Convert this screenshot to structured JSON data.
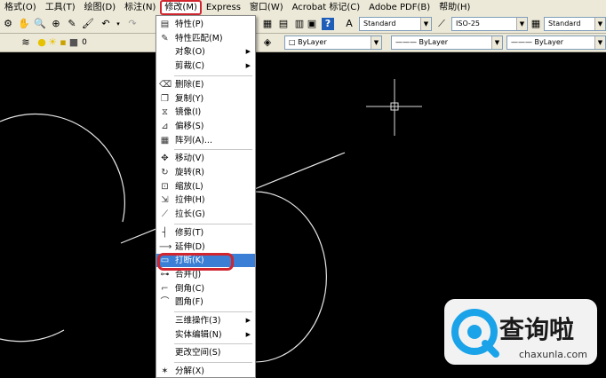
{
  "menubar": {
    "items": [
      "格式(O)",
      "工具(T)",
      "绘图(D)",
      "标注(N)",
      "修改(M)",
      "Express",
      "窗口(W)",
      "Acrobat 标记(C)",
      "Adobe PDF(B)",
      "帮助(H)"
    ],
    "active_index": 4
  },
  "toolbar": {
    "text_style": "Standard",
    "dim_style": "ISO-25",
    "table_style": "Standard",
    "layer_value": "0",
    "color": "ByLayer",
    "linetype": "ByLayer",
    "lineweight": "ByLayer"
  },
  "menu": {
    "items": [
      {
        "label": "特性(P)",
        "icon": "properties-icon"
      },
      {
        "label": "特性匹配(M)",
        "icon": "match-properties-icon"
      },
      {
        "label": "对象(O)",
        "icon": "",
        "sub": true
      },
      {
        "label": "剪裁(C)",
        "icon": "",
        "sub": true
      },
      {
        "label": "删除(E)",
        "icon": "erase-icon"
      },
      {
        "label": "复制(Y)",
        "icon": "copy-icon"
      },
      {
        "label": "镜像(I)",
        "icon": "mirror-icon"
      },
      {
        "label": "偏移(S)",
        "icon": "offset-icon"
      },
      {
        "label": "阵列(A)...",
        "icon": "array-icon"
      },
      {
        "label": "移动(V)",
        "icon": "move-icon"
      },
      {
        "label": "旋转(R)",
        "icon": "rotate-icon"
      },
      {
        "label": "缩放(L)",
        "icon": "scale-icon"
      },
      {
        "label": "拉伸(H)",
        "icon": "stretch-icon"
      },
      {
        "label": "拉长(G)",
        "icon": "lengthen-icon"
      },
      {
        "label": "修剪(T)",
        "icon": "trim-icon"
      },
      {
        "label": "延伸(D)",
        "icon": "extend-icon"
      },
      {
        "label": "打断(K)",
        "icon": "break-icon",
        "highlight": true
      },
      {
        "label": "合并(J)",
        "icon": "join-icon"
      },
      {
        "label": "倒角(C)",
        "icon": "chamfer-icon"
      },
      {
        "label": "圆角(F)",
        "icon": "fillet-icon"
      },
      {
        "label": "三维操作(3)",
        "icon": "",
        "sub": true
      },
      {
        "label": "实体编辑(N)",
        "icon": "",
        "sub": true
      },
      {
        "label": "更改空间(S)",
        "icon": ""
      },
      {
        "label": "分解(X)",
        "icon": "explode-icon"
      }
    ]
  },
  "watermark": {
    "title": "查询啦",
    "domain": "chaxunla.com",
    "brand_color": "#1aa3e8"
  }
}
